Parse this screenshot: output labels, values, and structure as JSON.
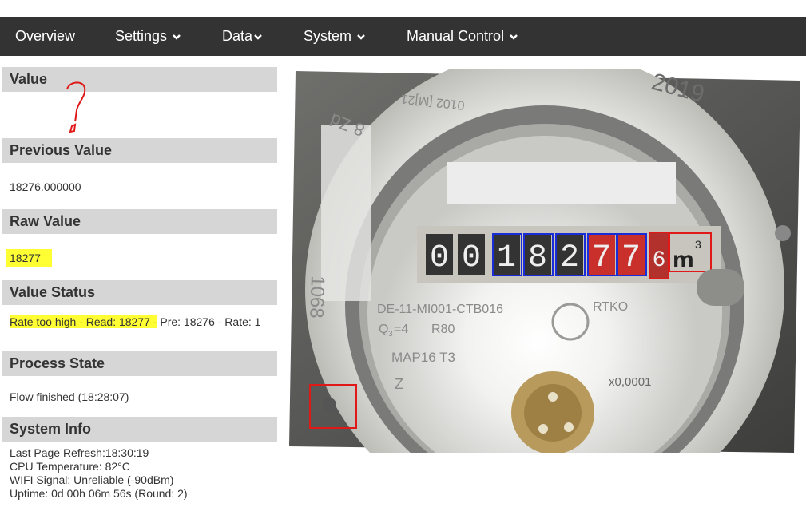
{
  "nav": {
    "items": [
      {
        "label": "Overview",
        "has_dropdown": false
      },
      {
        "label": "Settings",
        "has_dropdown": true
      },
      {
        "label": "Data",
        "has_dropdown": true
      },
      {
        "label": "System",
        "has_dropdown": true
      },
      {
        "label": "Manual Control",
        "has_dropdown": true
      }
    ]
  },
  "sections": {
    "value": {
      "title": "Value",
      "content": ""
    },
    "previous_value": {
      "title": "Previous Value",
      "content": "18276.000000"
    },
    "raw_value": {
      "title": "Raw Value",
      "content": "18277"
    },
    "value_status": {
      "title": "Value Status",
      "highlighted": "Rate too high - Read: 18277 -",
      "rest": " Pre: 18276 - Rate: 1"
    },
    "process_state": {
      "title": "Process State",
      "content": "Flow finished (18:28:07)"
    },
    "system_info": {
      "title": "System Info",
      "lines": [
        "Last Page Refresh:18:30:19",
        "CPU Temperature: 82°C",
        "WIFI Signal: Unreliable (-90dBm)",
        "Uptime: 0d 00h 06m 56s (Round: 2)"
      ]
    }
  },
  "meter": {
    "digits": [
      "0",
      "0",
      "1",
      "8",
      "2",
      "7",
      "7",
      "6"
    ],
    "unit": "m",
    "unit_sup": "3",
    "year": "2019",
    "ring_text_left": "1068",
    "ring_text_top": "8 Zd",
    "ring_text_code": "0102 [M]21",
    "model_line": "DE-11-MI001-CTB016",
    "q_label": "Q",
    "q_sub": "3",
    "q_value": "=4",
    "r_label": "R80",
    "map_label": "MAP16 T3",
    "z_label": "Z",
    "brand": "RTKO",
    "multiplier": "x0,0001"
  },
  "annotation": {
    "value_mark": "?",
    "digit_box_color": "#1a2bd8",
    "roi_box_color": "#e01818",
    "highlight_color": "#ffff33"
  }
}
